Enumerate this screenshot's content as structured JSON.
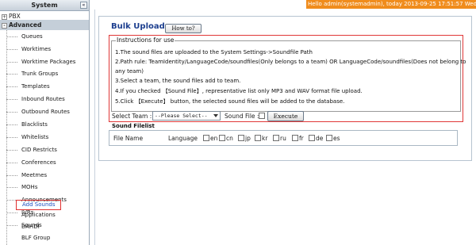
{
  "sidebar": {
    "header": "System",
    "collapse_icon": "«",
    "groups": [
      {
        "label": "PBX",
        "toggle": "+"
      },
      {
        "label": "Advanced",
        "toggle": "-"
      }
    ],
    "items": [
      "Queues",
      "Worktimes",
      "Worktime Packages",
      "Trunk Groups",
      "Templates",
      "Inbound Routes",
      "Outbound Routes",
      "Blacklists",
      "Whitelists",
      "CID Restricts",
      "Conferences",
      "Meetmes",
      "MOHs",
      "Announcements",
      "IVRs",
      "Sounds",
      "Add Sounds",
      "Applications",
      "DAHDI",
      "BLF Group"
    ],
    "selected_item": "Add Sounds"
  },
  "header": {
    "banner": "Hello admin(systemadmin), today 2013-09-25 17:51:57 Wednes"
  },
  "main": {
    "title": "Bulk Upload",
    "howto_label": "How to?",
    "instructions_legend": "Instructions for use",
    "instructions": [
      "1.The sound files are uploaded to the System Settings->Soundfile Path",
      "2.Path rule: TeamIdentity/LanguageCode/soundfiles(Only belongs to a team) OR LanguageCode/soundfiles(Does not belong to",
      "any team)",
      "3.Select a team, the sound files add to team.",
      "4.If you checked 【Sound File】, representative list only MP3 and WAV format file upload.",
      "5.Click 【Execute】 button, the selected sound files will be added to the database."
    ],
    "select_team_label": "Select Team :",
    "team_select_value": "--Please Select--",
    "sound_file_label": "Sound File :",
    "sound_file_checked": false,
    "execute_label": "Execute",
    "filelist_title": "Sound Filelist",
    "file_name_label": "File Name",
    "language_label": "Language",
    "languages": [
      "en",
      "cn",
      "jp",
      "kr",
      "ru",
      "fr",
      "de",
      "es"
    ]
  },
  "icons": {
    "select_arrow": "chevron-down-icon",
    "collapse": "double-chevron-left-icon"
  },
  "colors": {
    "banner_bg": "#f08c1c",
    "title": "#1d3f8f",
    "highlight_border": "#e03838",
    "selected_link": "#1a4fc0",
    "sidebar_group_bg": "#c5cfd9"
  }
}
